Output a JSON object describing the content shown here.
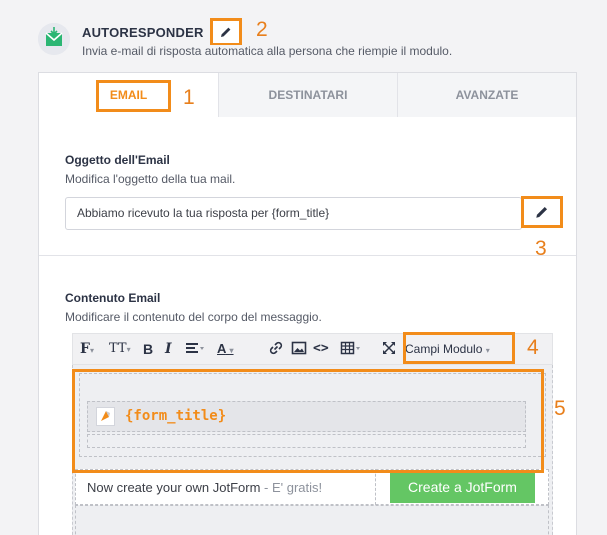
{
  "header": {
    "title": "AUTORESPONDER",
    "description": "Invia e-mail di risposta automatica alla persona che riempie il modulo."
  },
  "annotations": [
    "1",
    "2",
    "3",
    "4",
    "5"
  ],
  "tabs": [
    {
      "label": "EMAIL",
      "active": true
    },
    {
      "label": "DESTINATARI",
      "active": false
    },
    {
      "label": "AVANZATE",
      "active": false
    }
  ],
  "subject": {
    "title": "Oggetto dell'Email",
    "description": "Modifica l'oggetto della tua mail.",
    "value": "Abbiamo ricevuto la tua risposta per {form_title}"
  },
  "content": {
    "title": "Contenuto Email",
    "description": "Modificare il contenuto del corpo del messaggio."
  },
  "toolbar": {
    "font": "F",
    "font_size": "TT",
    "bold": "B",
    "italic": "I",
    "text_color": "A",
    "code": "<>",
    "campi_modulo": "Campi Modulo"
  },
  "editor": {
    "form_title": "{form_title}",
    "promo_text": "Now create your own JotForm",
    "promo_suffix": " - E' gratis!",
    "create_button": "Create a JotForm"
  },
  "colors": {
    "accent": "#f28c1a",
    "green_button": "#64c664",
    "icon_green": "#2bb673"
  }
}
